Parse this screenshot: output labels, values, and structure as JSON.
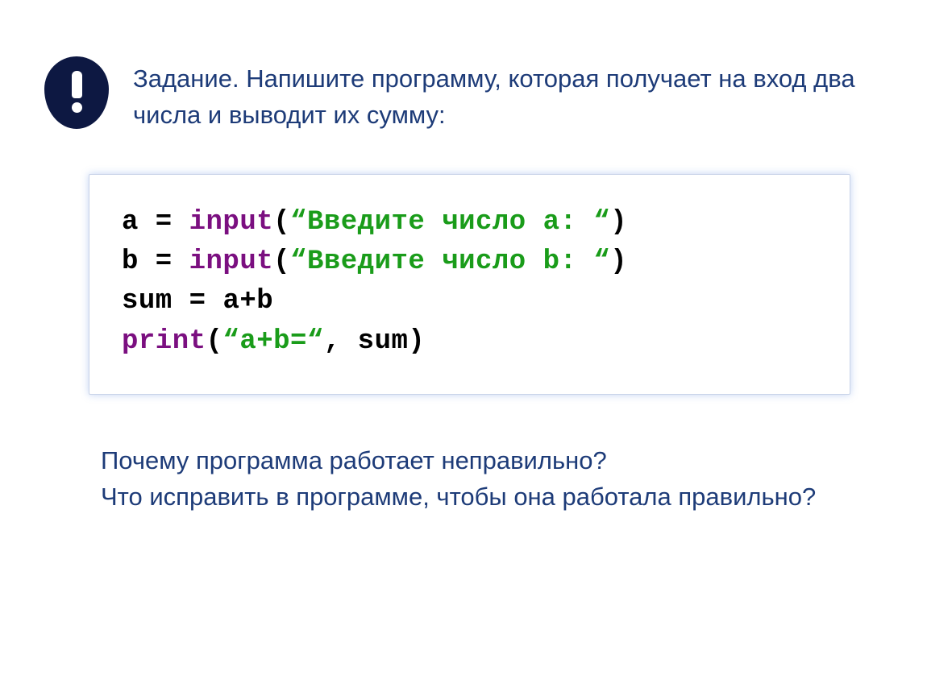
{
  "task": {
    "text": "Задание. Напишите программу, которая получает на вход два числа и выводит их сумму:"
  },
  "code": {
    "line1": {
      "var": "a",
      "eq": " = ",
      "func": "input",
      "open": "(",
      "str": "“Введите число a: “",
      "close": ")"
    },
    "line2": {
      "var": "b",
      "eq": " = ",
      "func": "input",
      "open": "(",
      "str": "“Введите число b: “",
      "close": ")"
    },
    "line3": {
      "var": "sum",
      "eq": " = ",
      "expr": "a+b"
    },
    "line4": {
      "func": "print",
      "open": "(",
      "str": "“a+b=“",
      "comma": ", ",
      "arg": "sum",
      "close": ")"
    }
  },
  "questions": {
    "q1": "Почему программа работает неправильно?",
    "q2": "Что исправить в программе, чтобы она работала правильно?"
  }
}
